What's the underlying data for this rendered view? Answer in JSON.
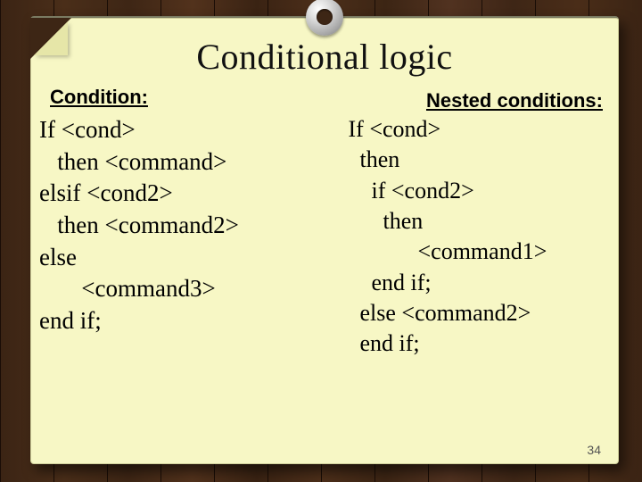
{
  "title": "Conditional logic",
  "subheadings": {
    "condition": "Condition:",
    "nested": "Nested conditions:"
  },
  "code_left": "If <cond>\n   then <command>\nelsif <cond2>\n   then <command2>\nelse\n       <command3>\nend if;",
  "code_right": " If <cond>\n   then\n     if <cond2>\n       then\n             <command1>\n     end if;\n   else <command2>\n   end if;",
  "page_number": "34"
}
